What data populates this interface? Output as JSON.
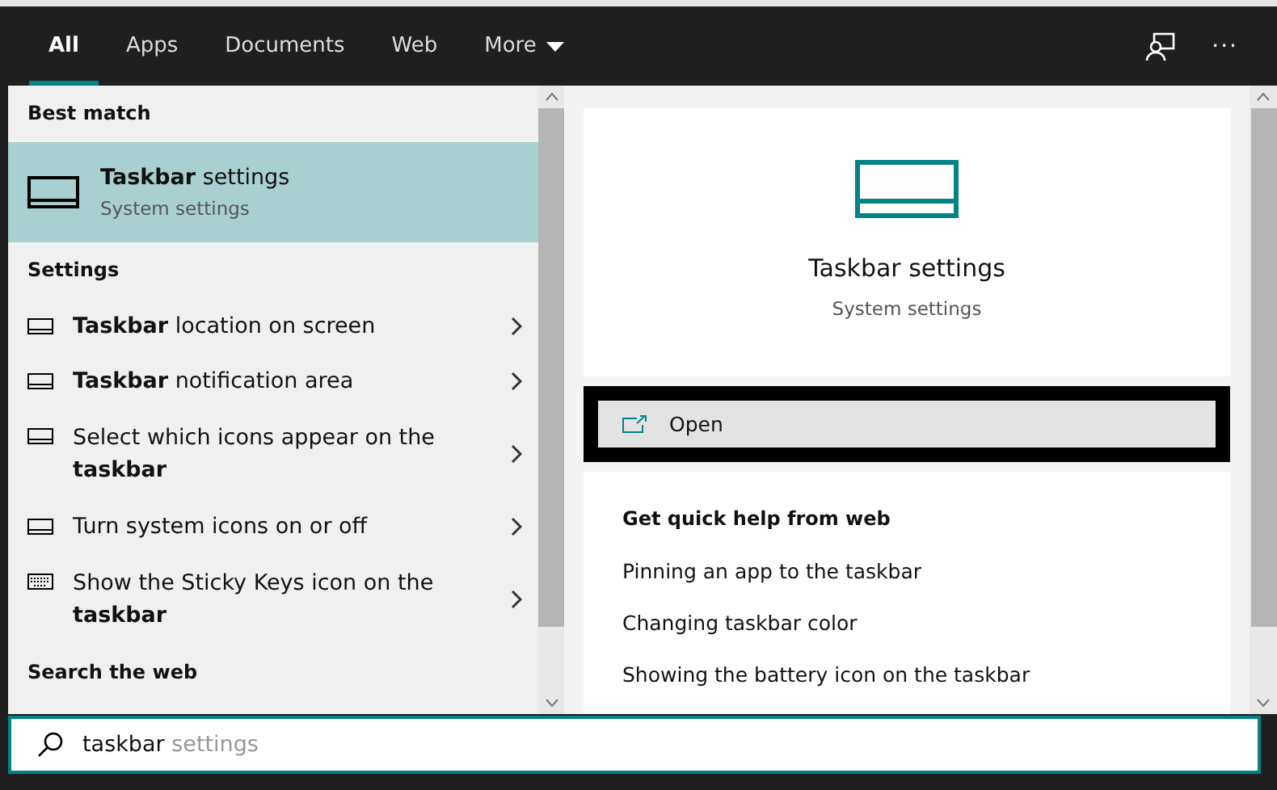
{
  "tabs": [
    {
      "label": "All",
      "selected": true
    },
    {
      "label": "Apps",
      "selected": false
    },
    {
      "label": "Documents",
      "selected": false
    },
    {
      "label": "Web",
      "selected": false
    },
    {
      "label": "More",
      "selected": false,
      "dropdown": true
    }
  ],
  "toolbar": {
    "more_label": "···"
  },
  "best_match": {
    "heading": "Best match",
    "title": "**Taskbar** settings",
    "subtitle": "System settings",
    "selected": true
  },
  "settings": {
    "heading": "Settings",
    "items": [
      {
        "kind": "display",
        "text": "**Taskbar** location on screen"
      },
      {
        "kind": "display",
        "text": "**Taskbar** notification area"
      },
      {
        "kind": "display",
        "text": "Select which icons appear on the **taskbar**"
      },
      {
        "kind": "display",
        "text": "Turn system icons on or off"
      },
      {
        "kind": "keyboard",
        "text": "Show the Sticky Keys icon on the **taskbar**"
      }
    ]
  },
  "web_heading": "Search the web",
  "preview": {
    "title": "Taskbar settings",
    "subtitle": "System settings",
    "open_label": "Open",
    "open_focused": true
  },
  "quick_help": {
    "heading": "Get quick help from web",
    "links": [
      "Pinning an app to the taskbar",
      "Changing taskbar color",
      "Showing the battery icon on the taskbar"
    ]
  },
  "search": {
    "value": "taskbar",
    "suggestion": "settings"
  }
}
